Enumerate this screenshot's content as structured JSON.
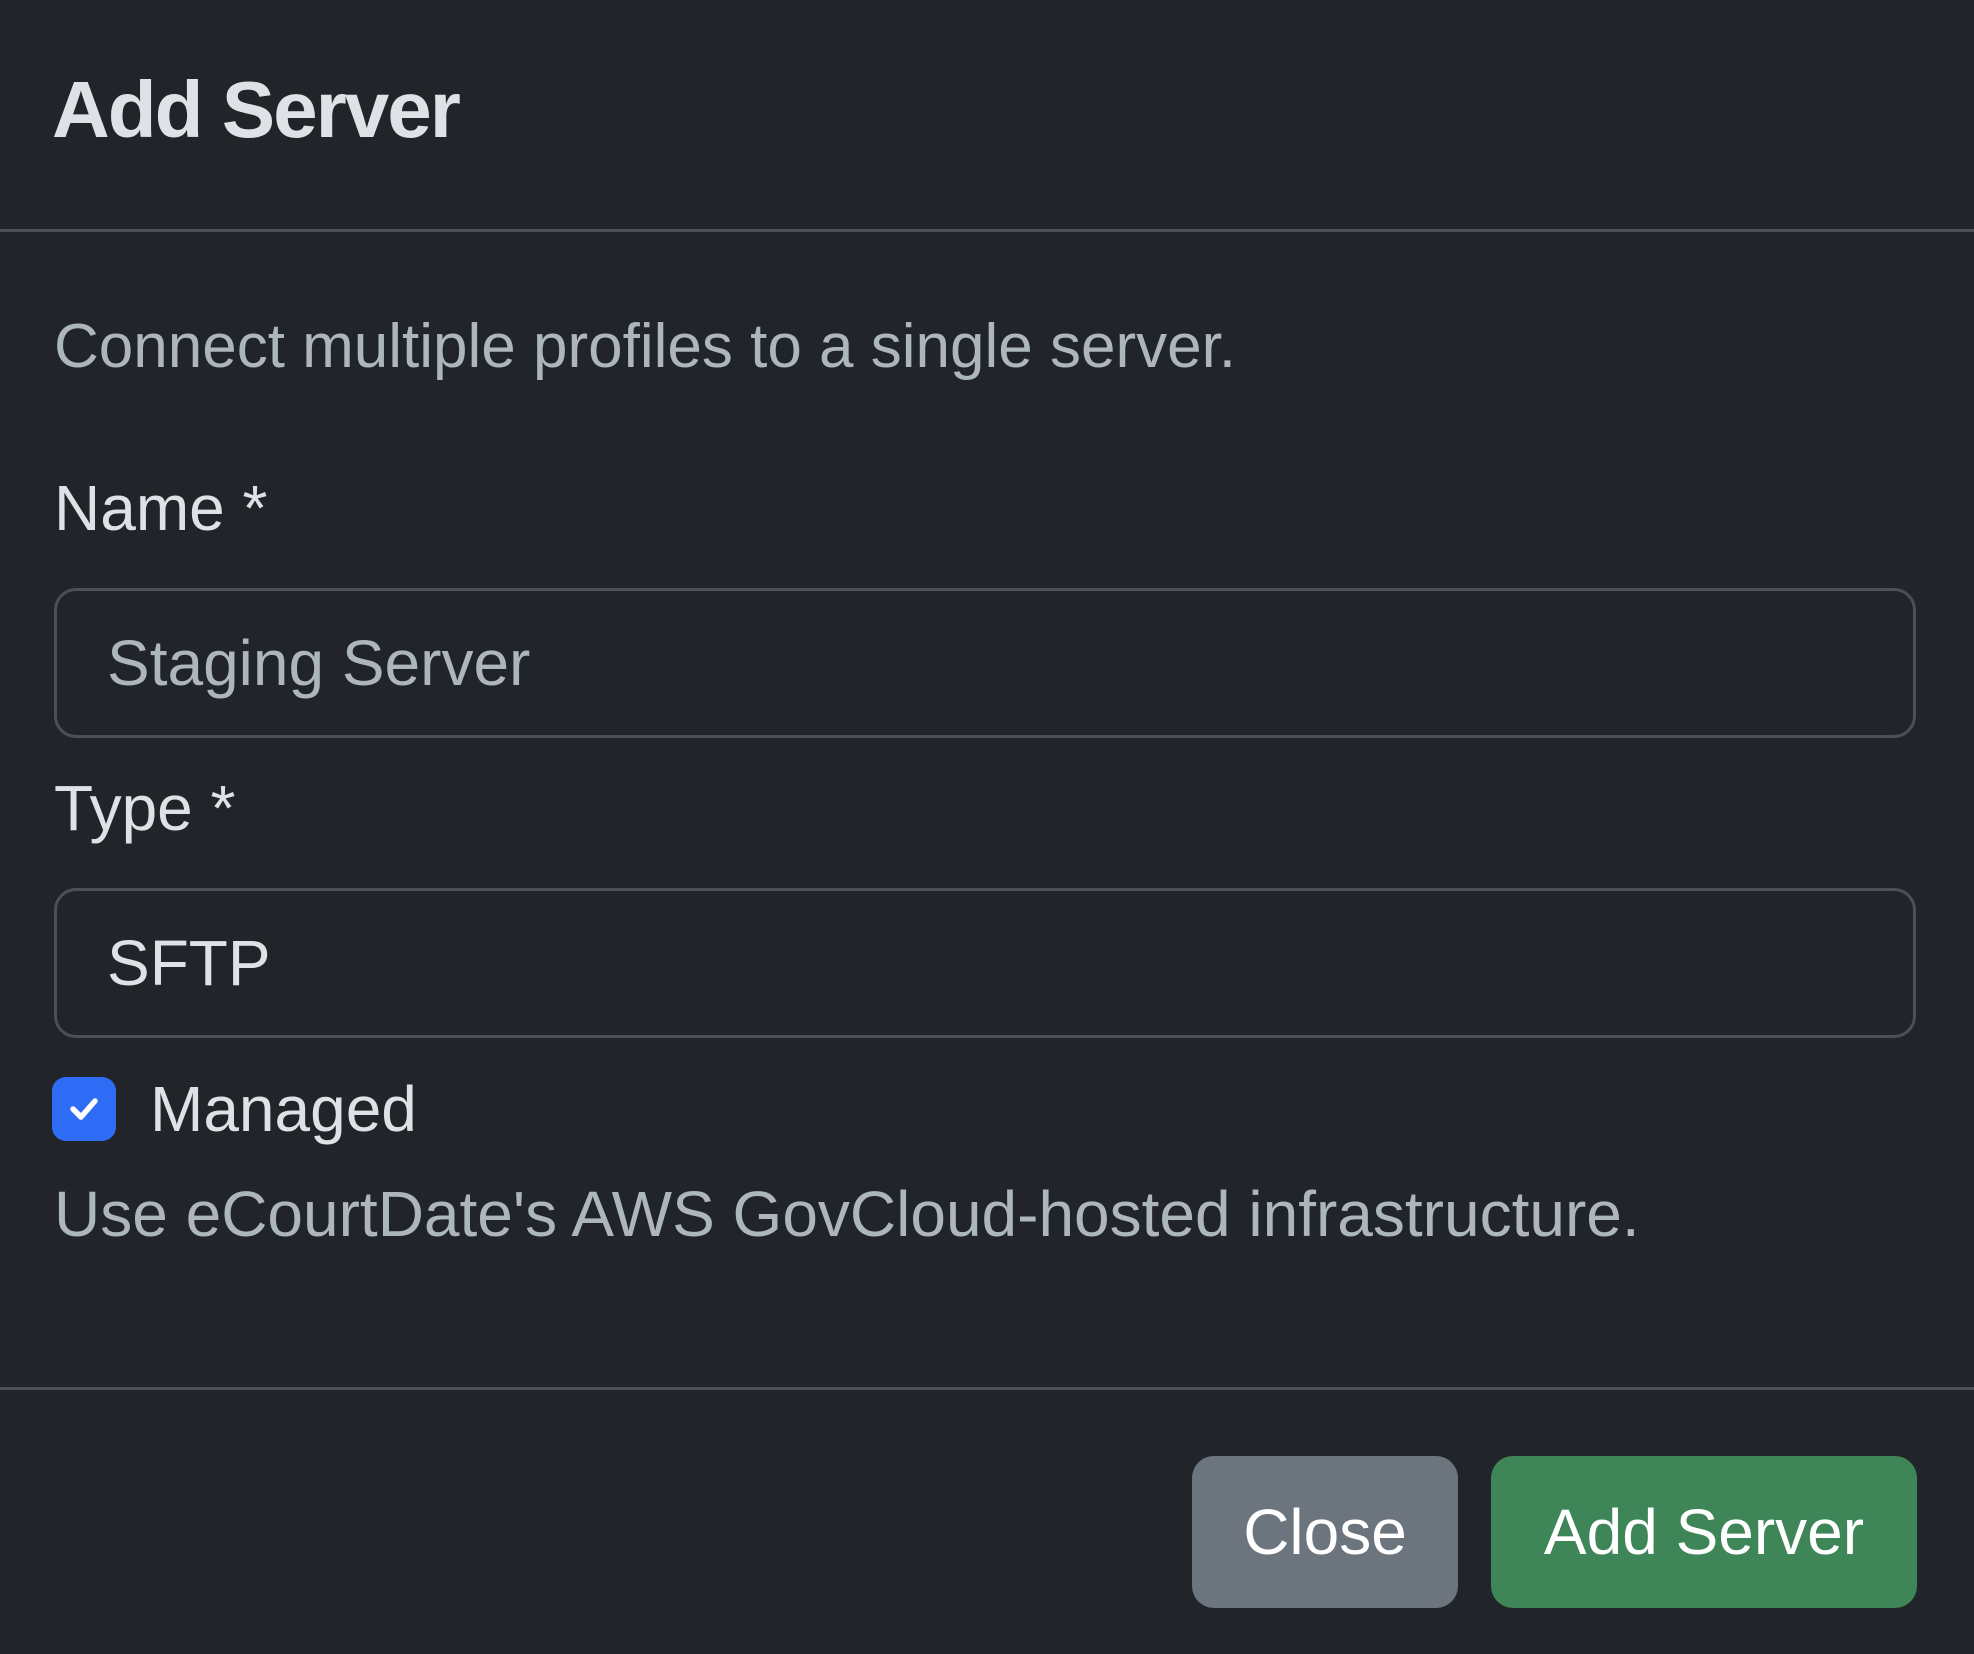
{
  "header": {
    "title": "Add Server"
  },
  "body": {
    "description": "Connect multiple profiles to a single server.",
    "name_field": {
      "label": "Name *",
      "value": "",
      "placeholder": "Staging Server"
    },
    "type_field": {
      "label": "Type *",
      "selected": "SFTP"
    },
    "managed": {
      "label": "Managed",
      "checked": true,
      "help": "Use eCourtDate's AWS GovCloud-hosted infrastructure."
    }
  },
  "footer": {
    "close_label": "Close",
    "submit_label": "Add Server"
  },
  "colors": {
    "background": "#212529",
    "checkbox": "#2f6cf5",
    "close_button": "#6c757d",
    "submit_button": "#3e8558"
  },
  "icons": {
    "checkbox": "checkmark-icon"
  }
}
